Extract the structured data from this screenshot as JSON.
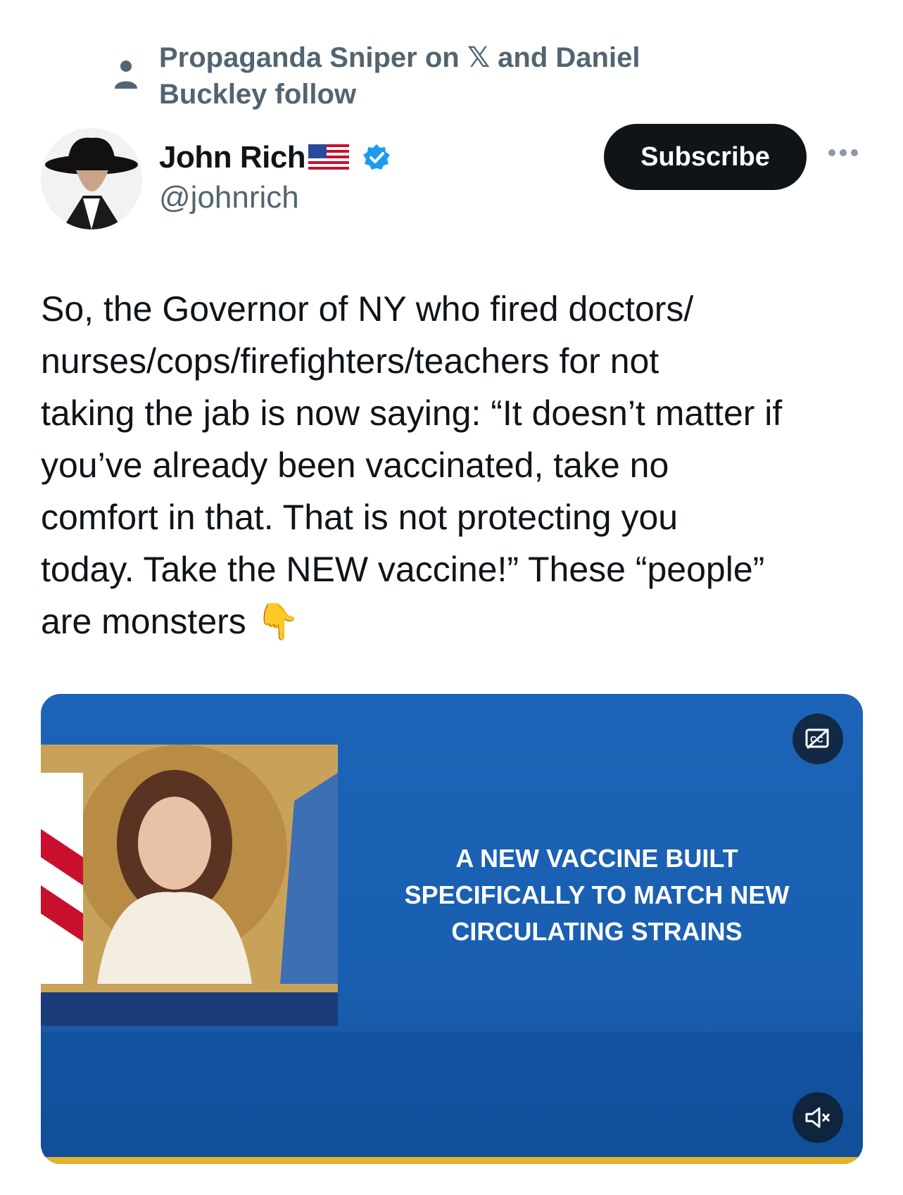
{
  "social_context": {
    "icon": "person-icon",
    "text": "Propaganda Sniper on 𝕏 and Daniel Buckley follow"
  },
  "author": {
    "display_name": "John Rich",
    "flag_icon": "us-flag-icon",
    "verified_icon": "verified-badge-icon",
    "verified_color": "#1d9bf0",
    "handle": "@johnrich",
    "avatar_icon": "avatar"
  },
  "actions": {
    "subscribe_label": "Subscribe",
    "more_icon": "more-icon"
  },
  "tweet": {
    "text": "So, the Governor of NY who fired doctors/\nnurses/cops/firefighters/teachers for not\ntaking the jab is now saying: “It doesn’t matter if\nyou’ve already been vaccinated, take no\ncomfort in that. That is not protecting you\ntoday. Take the NEW vaccine!” These “people”\nare monsters 👇"
  },
  "media": {
    "type": "video",
    "caption": "A NEW VACCINE BUILT SPECIFICALLY TO MATCH NEW CIRCULATING STRAINS",
    "cc_icon": "closed-captions-icon",
    "mute_icon": "muted-speaker-icon",
    "accent_color": "#1a5fb0"
  }
}
